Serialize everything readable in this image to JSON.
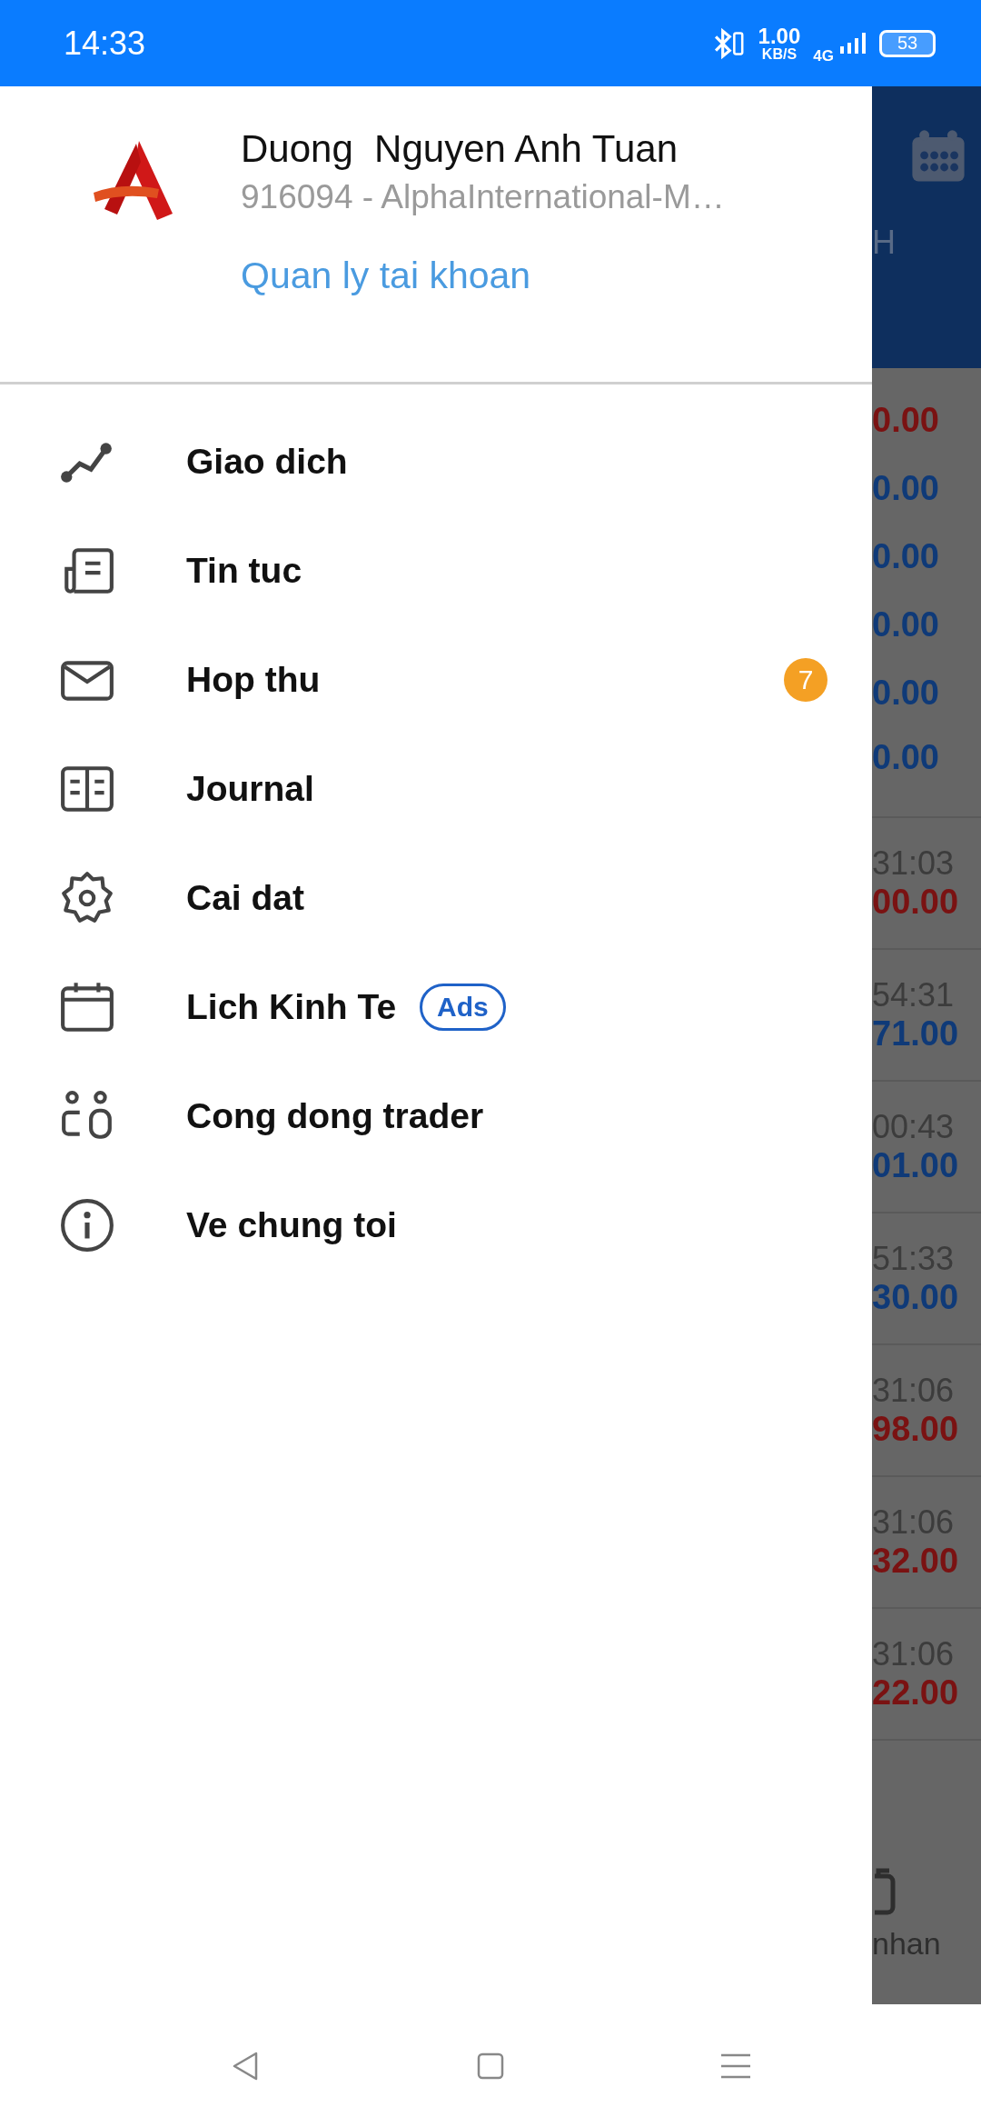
{
  "status_bar": {
    "time": "14:33",
    "speed": "1.00",
    "speed_unit": "KB/S",
    "network": "4G",
    "battery": "53"
  },
  "drawer": {
    "name": "Duong  Nguyen Anh Tuan",
    "account": "916094 - AlphaInternational-M…",
    "manage_link": "Quan ly tai khoan",
    "items": [
      {
        "kind": "chart",
        "label": "Giao dich"
      },
      {
        "kind": "news",
        "label": "Tin tuc"
      },
      {
        "kind": "mail",
        "label": "Hop thu",
        "badge": "7"
      },
      {
        "kind": "journal",
        "label": "Journal"
      },
      {
        "kind": "settings",
        "label": "Cai dat"
      },
      {
        "kind": "calendar",
        "label": "Lich Kinh Te",
        "tag": "Ads"
      },
      {
        "kind": "community",
        "label": "Cong dong trader"
      },
      {
        "kind": "info",
        "label": "Ve chung toi"
      }
    ]
  },
  "background_screen": {
    "header_label": "H",
    "rows": [
      {
        "kind": "quote",
        "value": "0.00",
        "color": "#7a1212"
      },
      {
        "kind": "quote",
        "value": "0.00",
        "color": "#0f3a78"
      },
      {
        "kind": "quote",
        "value": "0.00",
        "color": "#0f3a78"
      },
      {
        "kind": "quote",
        "value": "0.00",
        "color": "#0f3a78"
      },
      {
        "kind": "quote",
        "value": "0.00",
        "color": "#0f3a78"
      },
      {
        "kind": "quote",
        "value": "0.00",
        "color": "#0f3a78"
      },
      {
        "kind": "trade",
        "time": "31:03",
        "value": "00.00",
        "color": "#7a1212"
      },
      {
        "kind": "trade",
        "time": "54:31",
        "value": "71.00",
        "color": "#0f3a78"
      },
      {
        "kind": "trade",
        "time": "00:43",
        "value": "01.00",
        "color": "#0f3a78"
      },
      {
        "kind": "trade",
        "time": "51:33",
        "value": "30.00",
        "color": "#0f3a78"
      },
      {
        "kind": "trade",
        "time": "31:06",
        "value": "98.00",
        "color": "#7a1212"
      },
      {
        "kind": "trade",
        "time": "31:06",
        "value": "32.00",
        "color": "#7a1212"
      },
      {
        "kind": "trade",
        "time": "31:06",
        "value": "22.00",
        "color": "#7a1212"
      }
    ],
    "tab_label": "nhan"
  }
}
